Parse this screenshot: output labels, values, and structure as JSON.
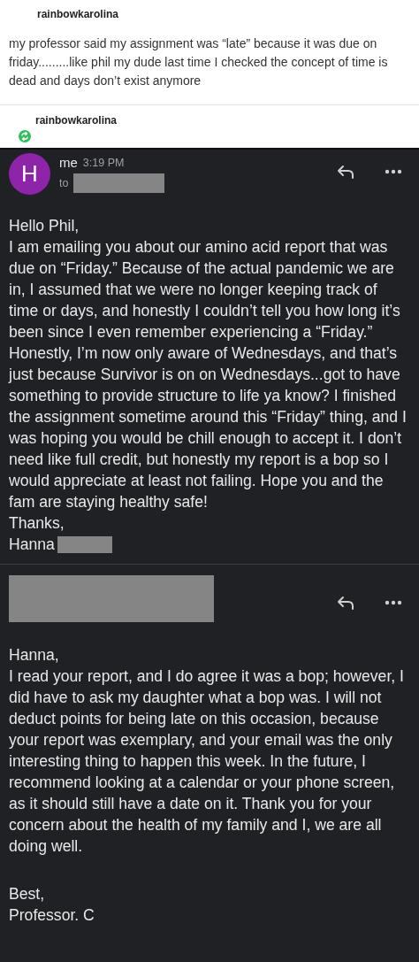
{
  "post": {
    "username": "rainbowkarolina",
    "text": "my professor said my assignment was “late” because it was due on friday.........like phil my dude last time I checked the concept of time is dead and days don’t exist anymore"
  },
  "reblog": {
    "username": "rainbowkarolina"
  },
  "emails": [
    {
      "avatar": "H",
      "sender": "me",
      "time": "3:19 PM",
      "to_label": "to",
      "greeting": "Hello Phil,",
      "body": "I am emailing you about our amino acid report that was due on “Friday.” Because of the actual pandemic we are in, I assumed that we were no longer keeping track of time or days, and honestly I couldn’t tell you how long it’s been since I even remember experiencing a “Friday.” Honestly, I’m now only aware of Wednesdays, and that’s just because Survivor is on on Wednesdays...got to have something to provide structure to life ya know? I finished the assignment sometime around this “Friday” thing, and I was hoping you would be chill enough to accept it. I don’t need like full credit, but honestly my report is a bop so I would appreciate at least not failing. Hope you and the fam are staying healthy safe!",
      "closing": "Thanks,",
      "signature": "Hanna"
    },
    {
      "greeting": "Hanna,",
      "body": "I read your report, and I do agree it was a bop; however, I did have to ask my daughter what a bop was. I will not deduct points for being late on this occasion, because your report was exemplary, and your email was the only interesting thing to happen this week. In the future, I recommend looking at a calendar or your phone screen, as it should still have a date on it. Thank you for your concern about the health of my family and I, we are all doing well.",
      "closing": "Best,",
      "signature": "Professor. C"
    }
  ]
}
